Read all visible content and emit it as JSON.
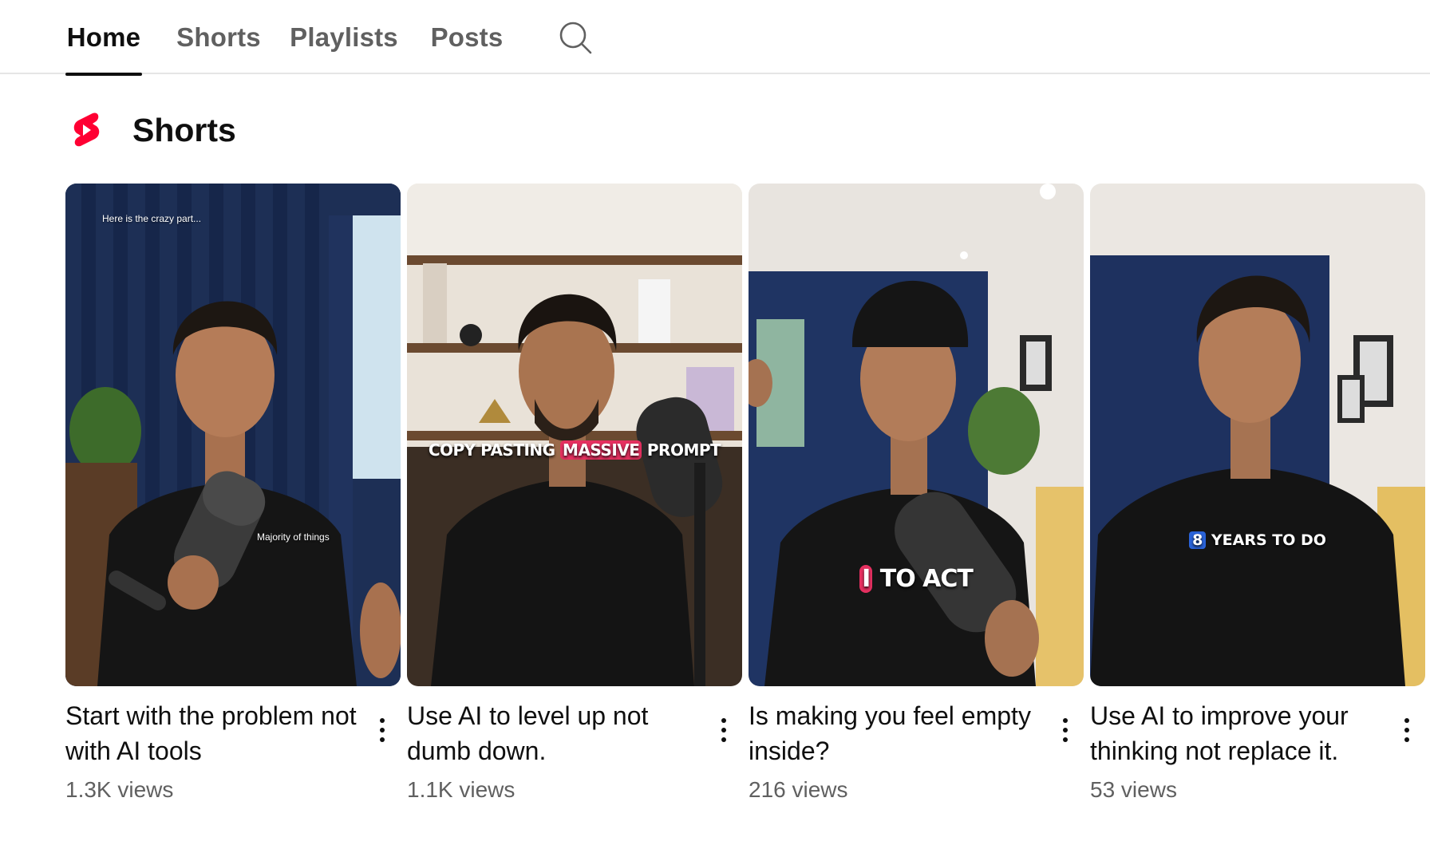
{
  "tabs": [
    {
      "label": "Home",
      "active": true
    },
    {
      "label": "Shorts",
      "active": false
    },
    {
      "label": "Playlists",
      "active": false
    },
    {
      "label": "Posts",
      "active": false
    }
  ],
  "search_icon": "search-icon",
  "section": {
    "title": "Shorts",
    "icon": "youtube-shorts-icon",
    "icon_color": "#ff0033"
  },
  "shorts": [
    {
      "title": "Start with the problem not with AI tools",
      "views": "1.3K views",
      "captions": [
        "Here is the crazy part...",
        "Majority of things"
      ]
    },
    {
      "title": "Use AI to level up not dumb down.",
      "views": "1.1K views",
      "caption_parts": [
        "COPY PASTING ",
        "MASSIVE",
        " PROMPT"
      ]
    },
    {
      "title": "Is making you feel empty inside?",
      "views": "216 views",
      "caption_parts": [
        "I",
        " TO ACT"
      ]
    },
    {
      "title": "Use AI to improve your thinking not replace it.",
      "views": "53 views",
      "caption_parts": [
        "8",
        " YEARS TO DO"
      ]
    }
  ],
  "colors": {
    "text_primary": "#0f0f0f",
    "text_secondary": "#606060",
    "divider": "#e5e5e5",
    "caption_highlight_red": "#e53060",
    "caption_highlight_blue": "#2a63d8"
  }
}
